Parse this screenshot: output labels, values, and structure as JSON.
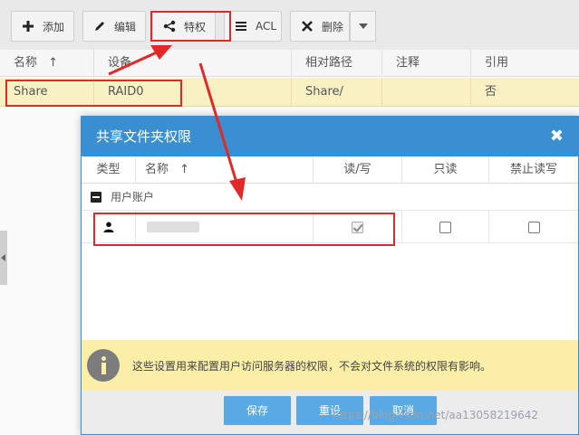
{
  "toolbar": {
    "add_label": "添加",
    "edit_label": "编辑",
    "privilege_label": "特权",
    "acl_label": "ACL",
    "delete_label": "删除"
  },
  "table": {
    "columns": [
      "名称",
      "设备",
      "相对路径",
      "注释",
      "引用"
    ],
    "sort_arrow": "↑",
    "row": {
      "name": "Share",
      "device": "RAID0",
      "path": "Share/",
      "comment": "",
      "ref": "否"
    }
  },
  "modal": {
    "title": "共享文件夹权限",
    "close_glyph": "✖",
    "columns": [
      "类型",
      "名称",
      "读/写",
      "只读",
      "禁止读写"
    ],
    "sort_arrow": "↑",
    "group_label": "用户账户",
    "user_row": {
      "read_write": true,
      "read_only": false,
      "no_access": false
    },
    "info_text": "这些设置用来配置用户访问服务器的权限，不会对文件系统的权限有影响。",
    "buttons": {
      "save": "保存",
      "reset": "重设",
      "cancel": "取消"
    }
  },
  "watermark": "https://blog.csdn.net/aa13058219642",
  "colors": {
    "accent": "#3a8fd0",
    "button": "#5aa9e3",
    "highlight_row": "#f9f0c4",
    "info_bar": "#fbeea6",
    "annotation": "#e02a2a"
  }
}
